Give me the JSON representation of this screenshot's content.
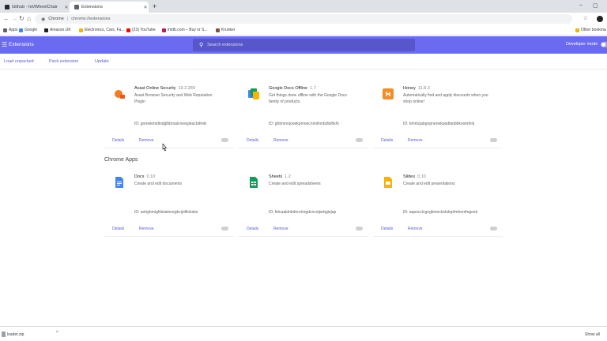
{
  "browser": {
    "tabs": [
      {
        "title": "Github - hrt/WheelChair",
        "favicon_color": "#24292e"
      },
      {
        "title": "Extensions",
        "favicon_color": "#5f6368"
      }
    ],
    "new_tab_glyph": "+",
    "window_controls": [
      "–",
      "▢"
    ],
    "address": {
      "scheme_label": "Chrome",
      "separator": "|",
      "url": "chrome://extensions"
    },
    "bookmarks": [
      {
        "label": "Apps",
        "color": "#5f6368"
      },
      {
        "label": "Google",
        "color": "#4285f4"
      },
      {
        "label": "Amazon.UK",
        "color": "#202124"
      },
      {
        "label": "Electronics, Cars, Fa...",
        "color": "#f4b400"
      },
      {
        "label": "(23) YouTube",
        "color": "#ff0000"
      },
      {
        "label": "imdb.com – Buy or S...",
        "color": "#c2185b"
      },
      {
        "label": "Krunker",
        "color": "#795548"
      },
      {
        "label": "Other bookma",
        "color": "#f4b400"
      }
    ]
  },
  "header": {
    "title": "Extensions",
    "search_placeholder": "Search extensions",
    "developer_mode_label": "Developer mode",
    "accent": "#6b6bf2"
  },
  "actions": {
    "load_unpacked": "Load unpacked",
    "pack_extension": "Pack extension",
    "update": "Update"
  },
  "extensions": [
    {
      "name": "Avast Online Security",
      "version": "19.2.289",
      "description": "Avast Browser Security and Web Reputation Plugin",
      "id": "ID: gomekmidlodglbbmalcneegieacbdmki",
      "details": "Details",
      "remove": "Remove",
      "icon_color": "#f47c20",
      "icon": "avast-icon"
    },
    {
      "name": "Google Docs Offline",
      "version": "1.7",
      "description": "Get things done offline with the Google Docs family of products.",
      "id": "ID: ghbmnnjooekpmoecnnnilnnbdlolhkhi",
      "details": "Details",
      "remove": "Remove",
      "icon_color": "#4285f4",
      "icon": "google-docs-offline-icon"
    },
    {
      "name": "Honey",
      "version": "11.8.3",
      "description": "Automatically find and apply discounts when you shop online!",
      "id": "ID: bmnlcjabgnpnenekpadlanbbkooimhnj",
      "details": "Details",
      "remove": "Remove",
      "icon_color": "#f08d27",
      "icon": "honey-icon"
    }
  ],
  "apps_section_title": "Chrome Apps",
  "apps": [
    {
      "name": "Docs",
      "version": "0.10",
      "description": "Create and edit documents",
      "id": "ID: aohghmighlieiainnegkcijnfilokake",
      "details": "Details",
      "remove": "Remove",
      "icon_color": "#4285f4",
      "icon": "docs-icon"
    },
    {
      "name": "Sheets",
      "version": "1.2",
      "description": "Create and edit spreadsheets",
      "id": "ID: felcaaldnbdncclmgdcncolpebgiejap",
      "details": "Details",
      "remove": "Remove",
      "icon_color": "#0f9d58",
      "icon": "sheets-icon"
    },
    {
      "name": "Slides",
      "version": "0.10",
      "description": "Create and edit presentations",
      "id": "ID: aapocclcgogkmnckokdopfmhonfmgoek",
      "details": "Details",
      "remove": "Remove",
      "icon_color": "#f4b400",
      "icon": "slides-icon"
    }
  ],
  "downloads": {
    "file": "loader.zip",
    "caret": "^",
    "show_all": "Show all"
  }
}
